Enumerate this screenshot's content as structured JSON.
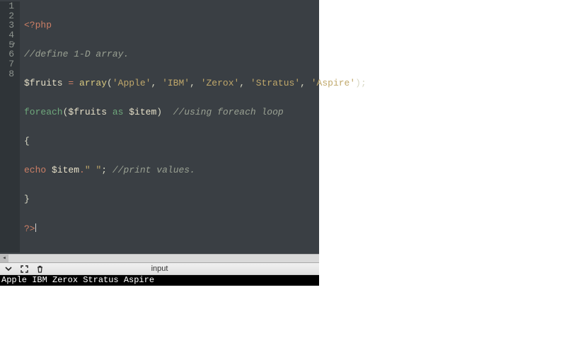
{
  "editor": {
    "line_numbers": [
      "1",
      "2",
      "3",
      "4",
      "5",
      "6",
      "7",
      "8"
    ],
    "fold_lines": [
      5
    ],
    "code": {
      "l1_open": "<?php",
      "l2_comment": "//define 1-D array.",
      "l3_var": "$fruits",
      "l3_eq": " = ",
      "l3_func": "array",
      "l3_p1": "(",
      "l3_s1": "'Apple'",
      "l3_c1": ", ",
      "l3_s2": "'IBM'",
      "l3_c2": ", ",
      "l3_s3": "'Zerox'",
      "l3_c3": ", ",
      "l3_s4": "'Stratus'",
      "l3_c4": ", ",
      "l3_s5": "'Aspire'",
      "l3_p2": ");",
      "l4_kw": "foreach",
      "l4_p1": "(",
      "l4_var1": "$fruits",
      "l4_as": " as ",
      "l4_var2": "$item",
      "l4_p2": ")  ",
      "l4_comment": "//using foreach loop",
      "l5_brace": "{",
      "l6_echo": "echo",
      "l6_sp": " ",
      "l6_var": "$item",
      "l6_dot": ".",
      "l6_str": "\" \"",
      "l6_semi": "; ",
      "l6_comment": "//print values.",
      "l7_brace": "}",
      "l8_close": "?>"
    }
  },
  "toolbar": {
    "input_label": "input"
  },
  "output": {
    "text": "Apple IBM Zerox Stratus Aspire "
  },
  "icons": {
    "chevron": "chevron-down-icon",
    "expand": "expand-icon",
    "trash": "trash-icon",
    "scroll_left": "scroll-left-icon"
  }
}
